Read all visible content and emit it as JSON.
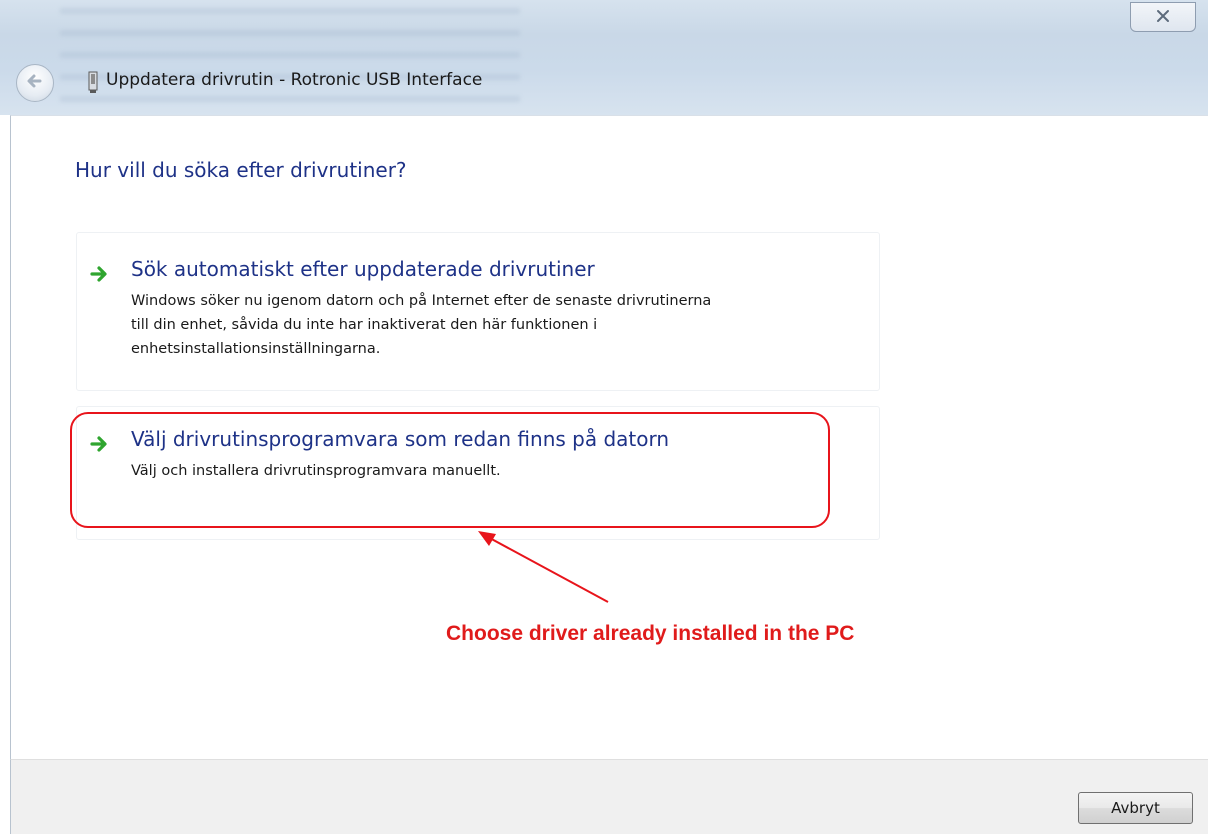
{
  "window": {
    "title": "Uppdatera drivrutin - Rotronic USB Interface",
    "close_glyph": "✕",
    "icons": {
      "back": "back-arrow-icon",
      "device": "usb-device-icon",
      "close": "close-icon"
    }
  },
  "main": {
    "heading": "Hur vill du söka efter drivrutiner?",
    "options": [
      {
        "icon": "green-arrow-icon",
        "title": "Sök automatiskt efter uppdaterade drivrutiner",
        "description_lines": [
          "Windows söker nu igenom datorn och på Internet efter de senaste drivrutinerna",
          "till din enhet, såvida du inte har inaktiverat den här funktionen i",
          "enhetsinstallationsinställningarna."
        ]
      },
      {
        "icon": "green-arrow-icon",
        "title": "Välj drivrutinsprogramvara som redan finns på datorn",
        "description_lines": [
          "Välj och installera drivrutinsprogramvara manuellt."
        ]
      }
    ]
  },
  "annotation": {
    "text": "Choose driver already installed in the PC",
    "color": "#e01b1b"
  },
  "footer": {
    "cancel_label": "Avbryt"
  },
  "colors": {
    "heading": "#1e3287",
    "accent_green": "#2fa52f",
    "annotation_red": "#e8141b"
  }
}
